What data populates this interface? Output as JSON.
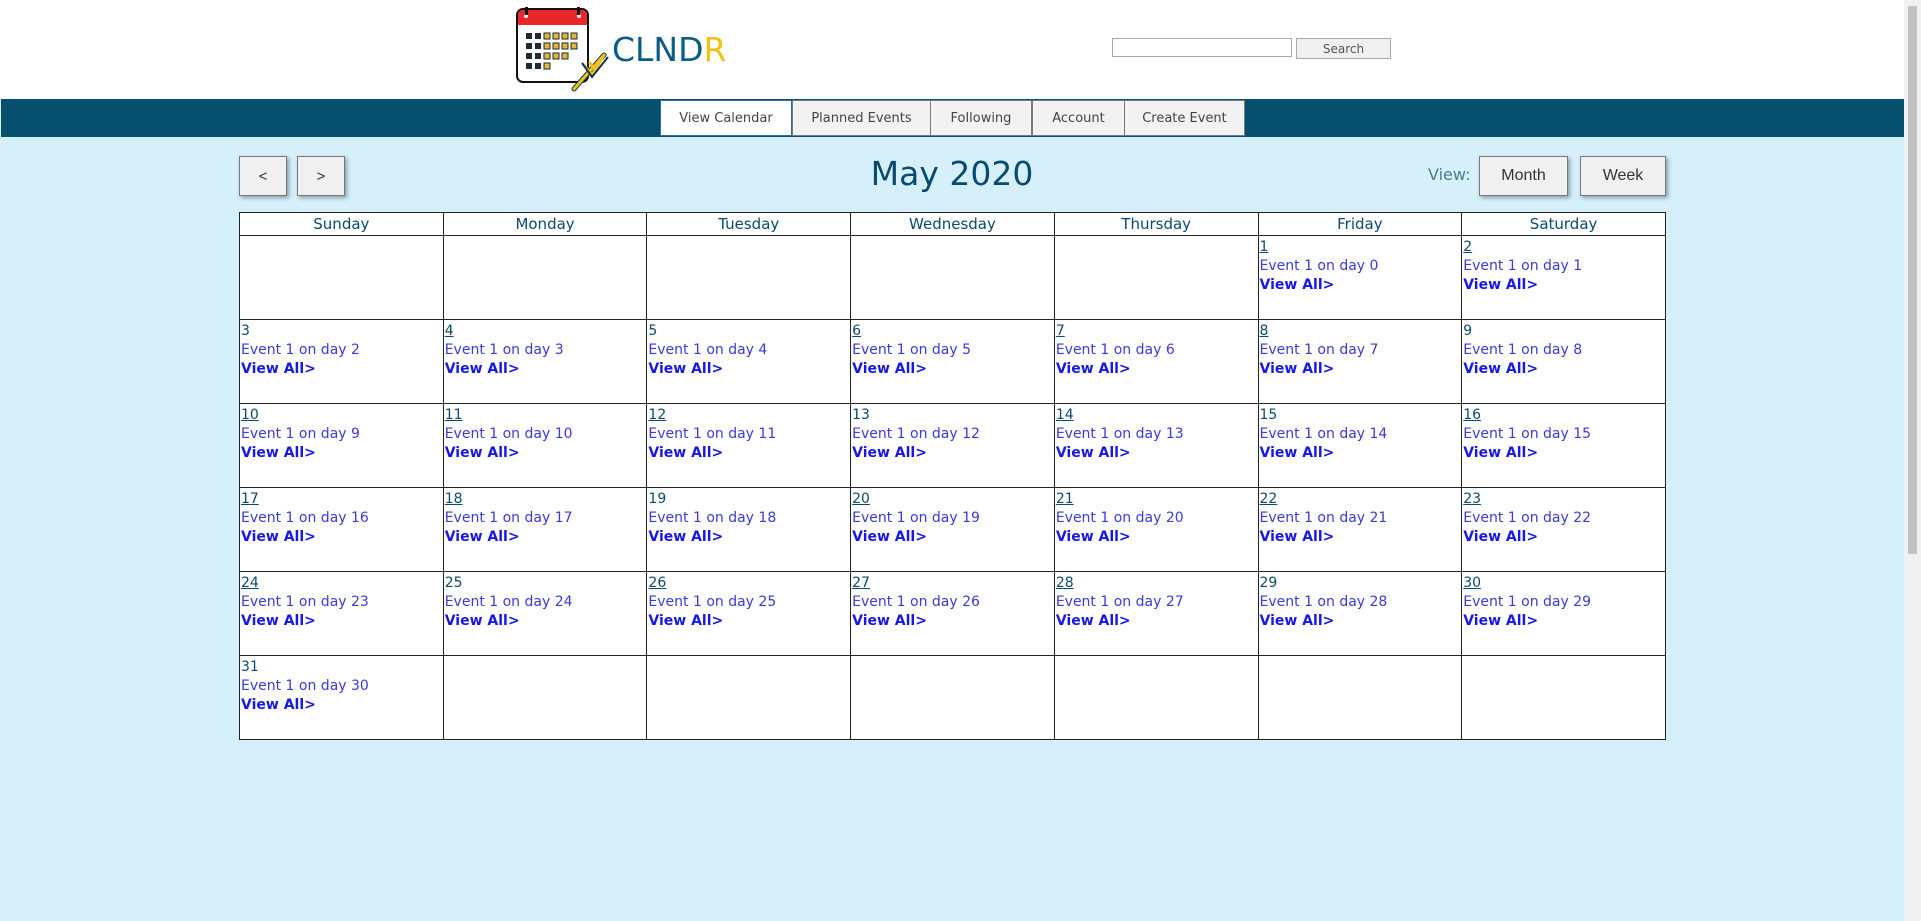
{
  "header": {
    "brand_prefix": "CLND",
    "brand_suffix": "R",
    "search": {
      "placeholder": "",
      "value": "",
      "button_label": "Search"
    }
  },
  "nav": {
    "tabs": [
      {
        "label": "View Calendar",
        "active": true
      },
      {
        "label": "Planned Events",
        "active": false
      },
      {
        "label": "Following",
        "active": false
      },
      {
        "label": "Account",
        "active": false
      },
      {
        "label": "Create Event",
        "active": false
      }
    ]
  },
  "toolbar": {
    "prev_label": "<",
    "next_label": ">",
    "month_title": "May 2020",
    "view_label": "View:",
    "month_button": "Month",
    "week_button": "Week"
  },
  "calendar": {
    "weekdays": [
      "Sunday",
      "Monday",
      "Tuesday",
      "Wednesday",
      "Thursday",
      "Friday",
      "Saturday"
    ],
    "view_all_label": "View All>",
    "weeks": [
      [
        null,
        null,
        null,
        null,
        null,
        {
          "day": "1",
          "event": "Event 1 on day 0"
        },
        {
          "day": "2",
          "event": "Event 1 on day 1"
        }
      ],
      [
        {
          "day": "3",
          "event": "Event 1 on day 2"
        },
        {
          "day": "4",
          "event": "Event 1 on day 3"
        },
        {
          "day": "5",
          "event": "Event 1 on day 4"
        },
        {
          "day": "6",
          "event": "Event 1 on day 5"
        },
        {
          "day": "7",
          "event": "Event 1 on day 6"
        },
        {
          "day": "8",
          "event": "Event 1 on day 7"
        },
        {
          "day": "9",
          "event": "Event 1 on day 8"
        }
      ],
      [
        {
          "day": "10",
          "event": "Event 1 on day 9"
        },
        {
          "day": "11",
          "event": "Event 1 on day 10"
        },
        {
          "day": "12",
          "event": "Event 1 on day 11"
        },
        {
          "day": "13",
          "event": "Event 1 on day 12"
        },
        {
          "day": "14",
          "event": "Event 1 on day 13"
        },
        {
          "day": "15",
          "event": "Event 1 on day 14"
        },
        {
          "day": "16",
          "event": "Event 1 on day 15"
        }
      ],
      [
        {
          "day": "17",
          "event": "Event 1 on day 16"
        },
        {
          "day": "18",
          "event": "Event 1 on day 17"
        },
        {
          "day": "19",
          "event": "Event 1 on day 18"
        },
        {
          "day": "20",
          "event": "Event 1 on day 19"
        },
        {
          "day": "21",
          "event": "Event 1 on day 20"
        },
        {
          "day": "22",
          "event": "Event 1 on day 21"
        },
        {
          "day": "23",
          "event": "Event 1 on day 22"
        }
      ],
      [
        {
          "day": "24",
          "event": "Event 1 on day 23"
        },
        {
          "day": "25",
          "event": "Event 1 on day 24"
        },
        {
          "day": "26",
          "event": "Event 1 on day 25"
        },
        {
          "day": "27",
          "event": "Event 1 on day 26"
        },
        {
          "day": "28",
          "event": "Event 1 on day 27"
        },
        {
          "day": "29",
          "event": "Event 1 on day 28"
        },
        {
          "day": "30",
          "event": "Event 1 on day 29"
        }
      ],
      [
        {
          "day": "31",
          "event": "Event 1 on day 30"
        },
        null,
        null,
        null,
        null,
        null,
        null
      ]
    ]
  },
  "colors": {
    "page_background": "#d5f0fb",
    "nav_bar": "#064f6f",
    "title_text": "#0a4a6c",
    "event_text": "#3a3ad6",
    "view_all_link": "#1717e6",
    "brand_blue": "#0a5d87",
    "brand_yellow": "#f2c21b"
  }
}
